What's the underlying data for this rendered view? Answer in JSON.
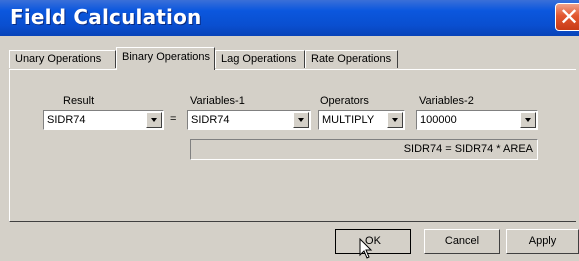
{
  "window": {
    "title": "Field Calculation",
    "close_glyph": "✕"
  },
  "tabs": [
    {
      "label": "Unary Operations"
    },
    {
      "label": "Binary Operations",
      "active": true
    },
    {
      "label": "Lag Operations"
    },
    {
      "label": "Rate Operations"
    }
  ],
  "form": {
    "result_label": "Result",
    "result_value": "SIDR74",
    "equals": "=",
    "variables1_label": "Variables-1",
    "variables1_value": "SIDR74",
    "operators_label": "Operators",
    "operators_value": "MULTIPLY",
    "variables2_label": "Variables-2",
    "variables2_value": "100000",
    "expression": "SIDR74 = SIDR74 * AREA"
  },
  "buttons": {
    "ok": "OK",
    "cancel": "Cancel",
    "apply": "Apply"
  }
}
